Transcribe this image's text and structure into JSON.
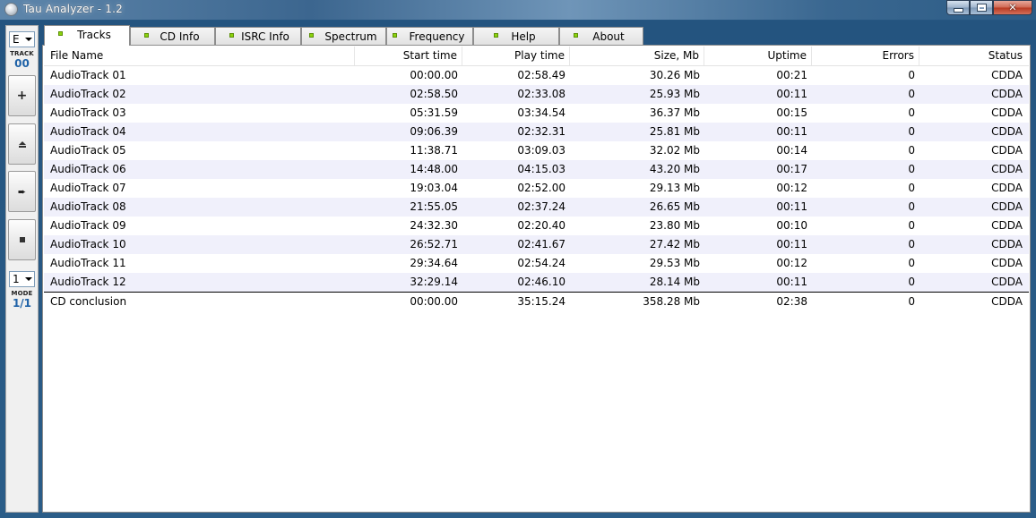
{
  "window": {
    "title": "Tau Analyzer - 1.2",
    "caption_buttons": [
      "minimize",
      "maximize",
      "close"
    ]
  },
  "sidebar": {
    "drive": "E",
    "track_label": "TRACK",
    "track_value": "00",
    "mode_select": "1",
    "mode_label": "MODE",
    "mode_value": "1/1",
    "buttons": [
      {
        "name": "add",
        "icon": "plus-icon"
      },
      {
        "name": "eject",
        "icon": "eject-icon"
      },
      {
        "name": "play",
        "icon": "play-icon"
      },
      {
        "name": "stop",
        "icon": "stop-icon"
      }
    ]
  },
  "tabs": [
    {
      "label": "Tracks",
      "active": true
    },
    {
      "label": "CD Info",
      "active": false
    },
    {
      "label": "ISRC Info",
      "active": false
    },
    {
      "label": "Spectrum",
      "active": false
    },
    {
      "label": "Frequency",
      "active": false
    },
    {
      "label": "Help",
      "active": false
    },
    {
      "label": "About",
      "active": false
    }
  ],
  "table": {
    "columns": [
      "File Name",
      "Start time",
      "Play time",
      "Size, Mb",
      "Uptime",
      "Errors",
      "Status"
    ],
    "rows": [
      [
        "AudioTrack 01",
        "00:00.00",
        "02:58.49",
        "30.26 Mb",
        "00:21",
        "0",
        "CDDA"
      ],
      [
        "AudioTrack 02",
        "02:58.50",
        "02:33.08",
        "25.93 Mb",
        "00:11",
        "0",
        "CDDA"
      ],
      [
        "AudioTrack 03",
        "05:31.59",
        "03:34.54",
        "36.37 Mb",
        "00:15",
        "0",
        "CDDA"
      ],
      [
        "AudioTrack 04",
        "09:06.39",
        "02:32.31",
        "25.81 Mb",
        "00:11",
        "0",
        "CDDA"
      ],
      [
        "AudioTrack 05",
        "11:38.71",
        "03:09.03",
        "32.02 Mb",
        "00:14",
        "0",
        "CDDA"
      ],
      [
        "AudioTrack 06",
        "14:48.00",
        "04:15.03",
        "43.20 Mb",
        "00:17",
        "0",
        "CDDA"
      ],
      [
        "AudioTrack 07",
        "19:03.04",
        "02:52.00",
        "29.13 Mb",
        "00:12",
        "0",
        "CDDA"
      ],
      [
        "AudioTrack 08",
        "21:55.05",
        "02:37.24",
        "26.65 Mb",
        "00:11",
        "0",
        "CDDA"
      ],
      [
        "AudioTrack 09",
        "24:32.30",
        "02:20.40",
        "23.80 Mb",
        "00:10",
        "0",
        "CDDA"
      ],
      [
        "AudioTrack 10",
        "26:52.71",
        "02:41.67",
        "27.42 Mb",
        "00:11",
        "0",
        "CDDA"
      ],
      [
        "AudioTrack 11",
        "29:34.64",
        "02:54.24",
        "29.53 Mb",
        "00:12",
        "0",
        "CDDA"
      ],
      [
        "AudioTrack 12",
        "32:29.14",
        "02:46.10",
        "28.14 Mb",
        "00:11",
        "0",
        "CDDA"
      ]
    ],
    "summary": [
      "CD conclusion",
      "00:00.00",
      "35:15.24",
      "358.28 Mb",
      "02:38",
      "0",
      "CDDA"
    ]
  }
}
